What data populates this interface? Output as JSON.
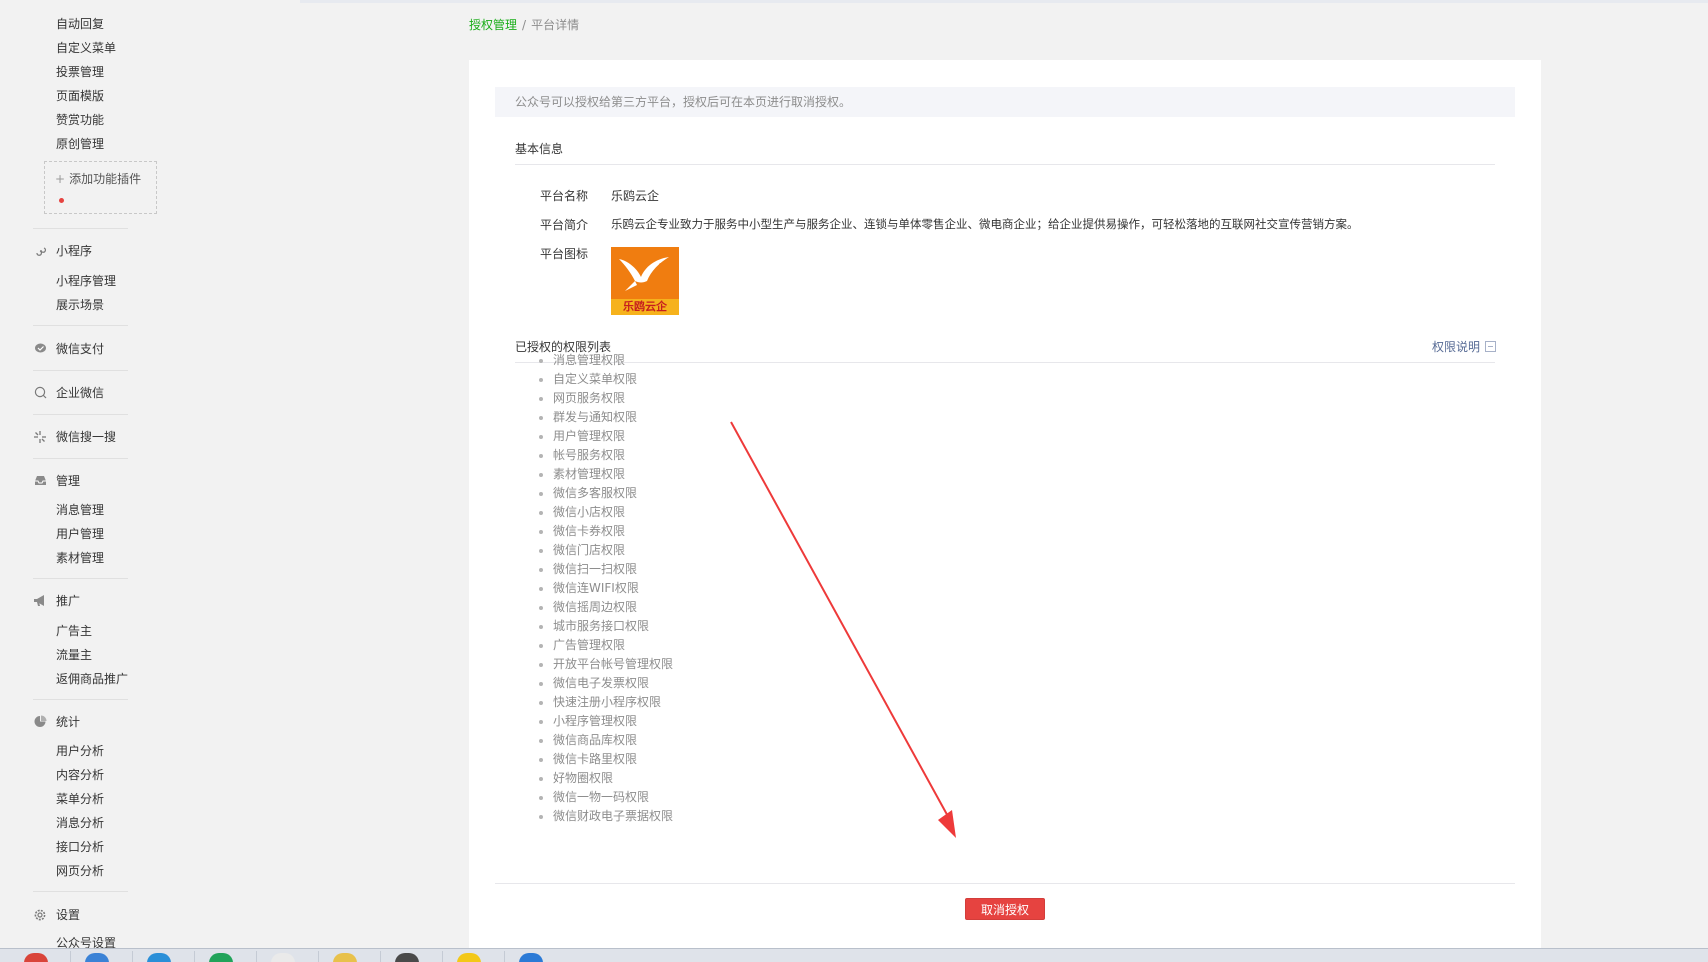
{
  "sidebar": {
    "group_top_items": [
      "自动回复",
      "自定义菜单",
      "投票管理",
      "页面模版",
      "赞赏功能",
      "原创管理"
    ],
    "add_plugin_label": "添加功能插件",
    "miniprogram": {
      "title": "小程序",
      "items": [
        "小程序管理",
        "展示场景"
      ]
    },
    "wxpay": {
      "title": "微信支付"
    },
    "wework": {
      "title": "企业微信"
    },
    "search": {
      "title": "微信搜一搜"
    },
    "manage": {
      "title": "管理",
      "items": [
        "消息管理",
        "用户管理",
        "素材管理"
      ]
    },
    "promote": {
      "title": "推广",
      "items": [
        "广告主",
        "流量主",
        "返佣商品推广"
      ]
    },
    "stats": {
      "title": "统计",
      "items": [
        "用户分析",
        "内容分析",
        "菜单分析",
        "消息分析",
        "接口分析",
        "网页分析"
      ]
    },
    "settings": {
      "title": "设置",
      "items": [
        "公众号设置"
      ]
    }
  },
  "breadcrumb": {
    "link": "授权管理",
    "separator": "/",
    "current": "平台详情"
  },
  "notice": "公众号可以授权给第三方平台，授权后可在本页进行取消授权。",
  "basic_info": {
    "title": "基本信息",
    "name_label": "平台名称",
    "name_value": "乐鸥云企",
    "intro_label": "平台简介",
    "intro_value": "乐鸥云企专业致力于服务中小型生产与服务企业、连锁与单体零售企业、微电商企业；给企业提供易操作，可轻松落地的互联网社交宣传营销方案。",
    "icon_label": "平台图标",
    "logo_text": "乐鸥云企"
  },
  "permissions": {
    "title": "已授权的权限列表",
    "help_link": "权限说明",
    "items": [
      "消息管理权限",
      "自定义菜单权限",
      "网页服务权限",
      "群发与通知权限",
      "用户管理权限",
      "帐号服务权限",
      "素材管理权限",
      "微信多客服权限",
      "微信小店权限",
      "微信卡券权限",
      "微信门店权限",
      "微信扫一扫权限",
      "微信连WIFI权限",
      "微信摇周边权限",
      "城市服务接口权限",
      "广告管理权限",
      "开放平台帐号管理权限",
      "微信电子发票权限",
      "快速注册小程序权限",
      "小程序管理权限",
      "微信商品库权限",
      "微信卡路里权限",
      "好物圈权限",
      "微信一物一码权限",
      "微信财政电子票据权限"
    ]
  },
  "cancel_button": "取消授权",
  "colors": {
    "accent_green": "#1aad19",
    "danger_red": "#e64340",
    "link_blue": "#576b95"
  }
}
